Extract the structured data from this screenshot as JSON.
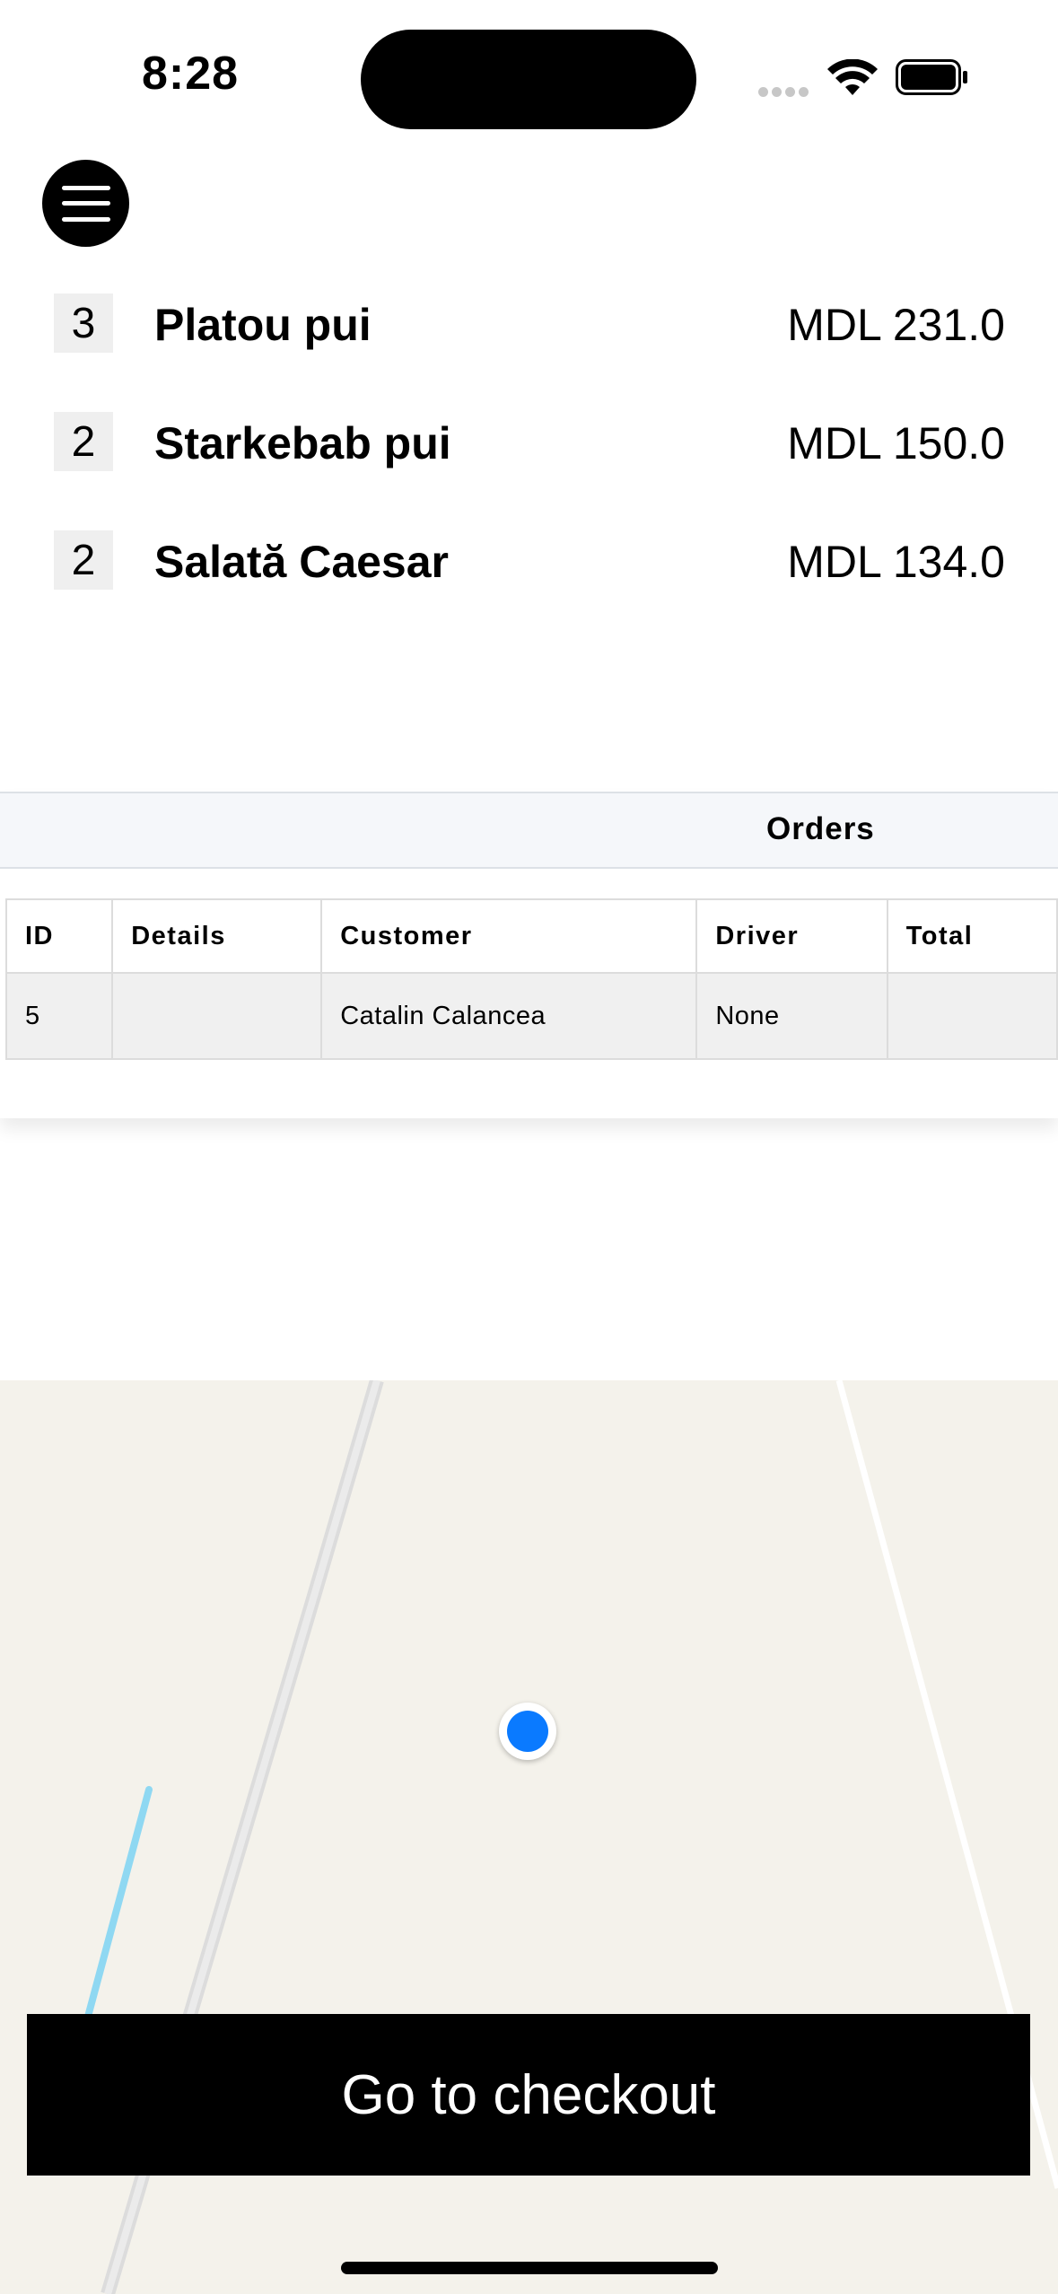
{
  "status_bar": {
    "time": "8:28"
  },
  "menu": {
    "icon": "hamburger-menu-icon"
  },
  "cart": {
    "items": [
      {
        "quantity": "3",
        "name": "Platou pui",
        "price": "MDL 231.0"
      },
      {
        "quantity": "2",
        "name": "Starkebab pui",
        "price": "MDL 150.0"
      },
      {
        "quantity": "2",
        "name": "Salată Caesar",
        "price": "MDL 134.0"
      }
    ]
  },
  "orders": {
    "title": "Orders",
    "columns": [
      "ID",
      "Details",
      "Customer",
      "Driver",
      "Total"
    ],
    "rows": [
      {
        "id": "5",
        "details": "",
        "customer": "Catalin Calancea",
        "driver": "None",
        "total": ""
      }
    ]
  },
  "map": {
    "user_location_color": "#0a7aff",
    "background_color": "#f4f2eb"
  },
  "checkout": {
    "label": "Go to checkout"
  }
}
